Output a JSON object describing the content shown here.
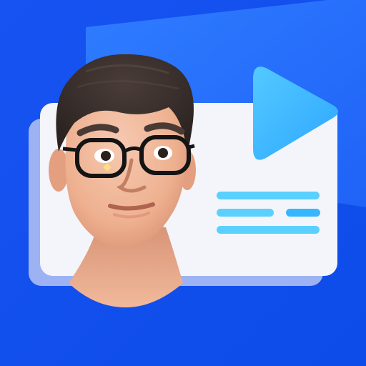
{
  "colors": {
    "background": "#1456f0",
    "back_panel": "#2d78ff",
    "card": "#f2f4fb",
    "card_shadow": "#9fb3f1",
    "play_button": "#4fc6ff",
    "text_lines": "#5bd2ff",
    "text_accent": "#32b4ff",
    "skin": "#f0b596",
    "hair": "#3a2f2c",
    "glasses": "#151515"
  },
  "icons": {
    "play": "play-icon",
    "avatar": "avatar-3d-man-with-glasses"
  },
  "text_lines": [
    1,
    0.55,
    0.34,
    1
  ]
}
